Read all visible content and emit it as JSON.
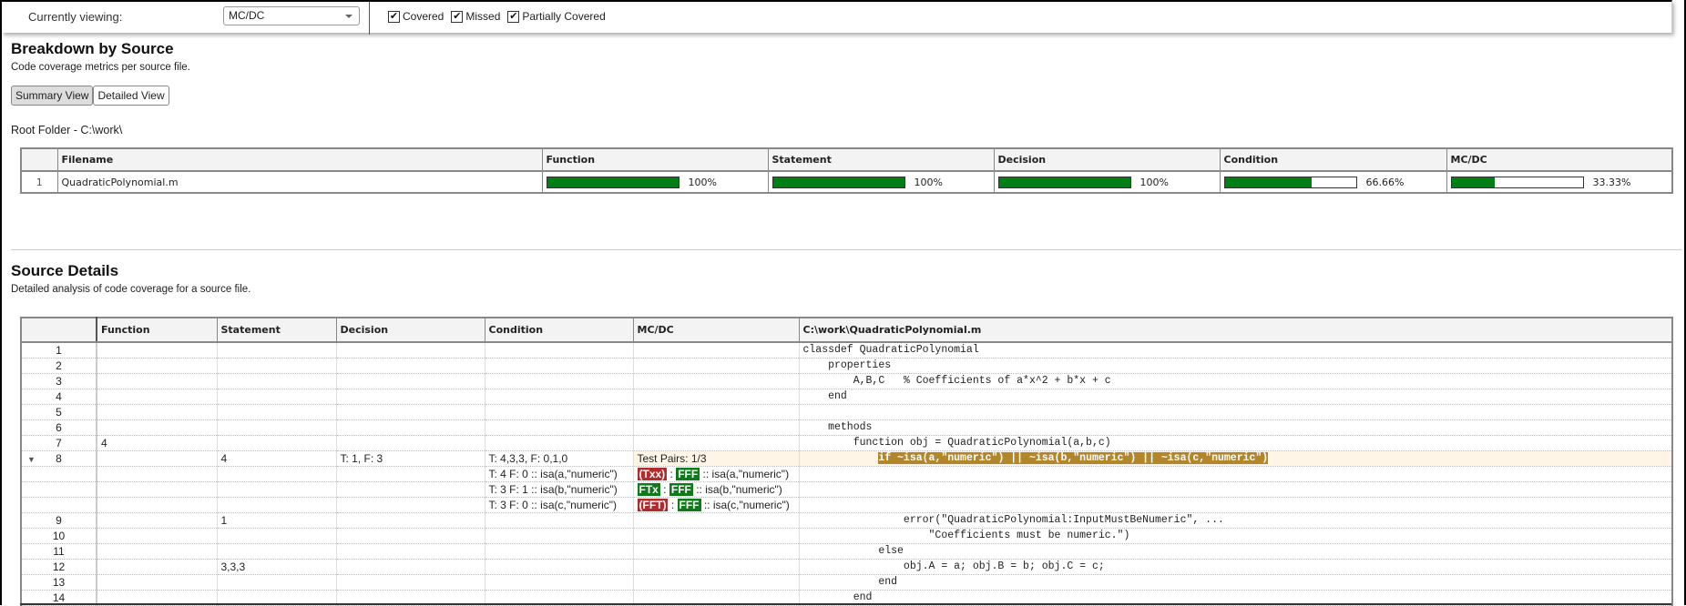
{
  "toolbar": {
    "viewing_label": "Currently viewing:",
    "viewing_value": "MC/DC",
    "checkboxes": [
      {
        "label": "Covered",
        "checked": true
      },
      {
        "label": "Missed",
        "checked": true
      },
      {
        "label": "Partially Covered",
        "checked": true
      }
    ]
  },
  "breakdown": {
    "title": "Breakdown by Source",
    "subtitle": "Code coverage metrics per source file.",
    "views": [
      {
        "label": "Summary View",
        "active": true
      },
      {
        "label": "Detailed View",
        "active": false
      }
    ],
    "root_folder": "Root Folder - C:\\work\\",
    "columns": [
      "",
      "Filename",
      "Function",
      "Statement",
      "Decision",
      "Condition",
      "MC/DC"
    ],
    "rows": [
      {
        "index": "1",
        "filename": "QuadraticPolynomial.m",
        "metrics": [
          {
            "percent": 100,
            "label": "100%"
          },
          {
            "percent": 100,
            "label": "100%"
          },
          {
            "percent": 100,
            "label": "100%"
          },
          {
            "percent": 66.66,
            "label": "66.66%"
          },
          {
            "percent": 33.33,
            "label": "33.33%"
          }
        ]
      }
    ],
    "colors": {
      "covered": "#008014"
    }
  },
  "details": {
    "title": "Source Details",
    "subtitle": "Detailed analysis of code coverage for a source file.",
    "columns": [
      "",
      "Function",
      "Statement",
      "Decision",
      "Condition",
      "MC/DC",
      "C:\\work\\QuadraticPolynomial.m"
    ],
    "rows": [
      {
        "line": "1",
        "function": "",
        "statement": "",
        "decision": "",
        "condition": "",
        "mcdc": "",
        "code": "classdef QuadraticPolynomial"
      },
      {
        "line": "2",
        "function": "",
        "statement": "",
        "decision": "",
        "condition": "",
        "mcdc": "",
        "code": "    properties"
      },
      {
        "line": "3",
        "function": "",
        "statement": "",
        "decision": "",
        "condition": "",
        "mcdc": "",
        "code": "        A,B,C   % Coefficients of a*x^2 + b*x + c"
      },
      {
        "line": "4",
        "function": "",
        "statement": "",
        "decision": "",
        "condition": "",
        "mcdc": "",
        "code": "    end"
      },
      {
        "line": "5",
        "function": "",
        "statement": "",
        "decision": "",
        "condition": "",
        "mcdc": "",
        "code": ""
      },
      {
        "line": "6",
        "function": "",
        "statement": "",
        "decision": "",
        "condition": "",
        "mcdc": "",
        "code": "    methods"
      },
      {
        "line": "7",
        "function": "4",
        "statement": "",
        "decision": "",
        "condition": "",
        "mcdc": "",
        "code": "        function obj = QuadraticPolynomial(a,b,c)"
      },
      {
        "line": "8",
        "expanded": true,
        "function": "",
        "statement": "4",
        "decision": "T: 1, F: 3",
        "condition": "T: 4,3,3, F: 0,1,0",
        "mcdc": "Test Pairs: 1/3",
        "code_indent": "            ",
        "code_highlight": "if ~isa(a,\"numeric\") || ~isa(b,\"numeric\") || ~isa(c,\"numeric\")"
      },
      {
        "sub": true,
        "condition": "T: 4 F: 0 :: isa(a,\"numeric\")",
        "mcdc_tag1": "(Txx)",
        "mcdc_tag1_status": "missed",
        "mcdc_tag2": "FFF",
        "mcdc_tag2_status": "covered",
        "mcdc_expr": " :: isa(a,\"numeric\")"
      },
      {
        "sub": true,
        "condition": "T: 3 F: 1 :: isa(b,\"numeric\")",
        "mcdc_tag1": "FTx",
        "mcdc_tag1_status": "covered",
        "mcdc_tag2": "FFF",
        "mcdc_tag2_status": "covered",
        "mcdc_expr": " :: isa(b,\"numeric\")"
      },
      {
        "sub": true,
        "condition": "T: 3 F: 0 :: isa(c,\"numeric\")",
        "mcdc_tag1": "(FFT)",
        "mcdc_tag1_status": "missed",
        "mcdc_tag2": "FFF",
        "mcdc_tag2_status": "covered",
        "mcdc_expr": " :: isa(c,\"numeric\")"
      },
      {
        "line": "9",
        "function": "",
        "statement": "1",
        "decision": "",
        "condition": "",
        "mcdc": "",
        "code": "                error(\"QuadraticPolynomial:InputMustBeNumeric\", ..."
      },
      {
        "line": "10",
        "function": "",
        "statement": "",
        "decision": "",
        "condition": "",
        "mcdc": "",
        "code": "                    \"Coefficients must be numeric.\")"
      },
      {
        "line": "11",
        "function": "",
        "statement": "",
        "decision": "",
        "condition": "",
        "mcdc": "",
        "code": "            else"
      },
      {
        "line": "12",
        "function": "",
        "statement": "3,3,3",
        "decision": "",
        "condition": "",
        "mcdc": "",
        "code": "                obj.A = a; obj.B = b; obj.C = c;"
      },
      {
        "line": "13",
        "function": "",
        "statement": "",
        "decision": "",
        "condition": "",
        "mcdc": "",
        "code": "            end"
      },
      {
        "line": "14",
        "function": "",
        "statement": "",
        "decision": "",
        "condition": "",
        "mcdc": "",
        "code": "        end"
      }
    ],
    "colors": {
      "highlight_row": "#fff5e6",
      "code_highlight": "#b4862a",
      "missed": "#b22a2a",
      "covered": "#0e7a1a"
    }
  }
}
